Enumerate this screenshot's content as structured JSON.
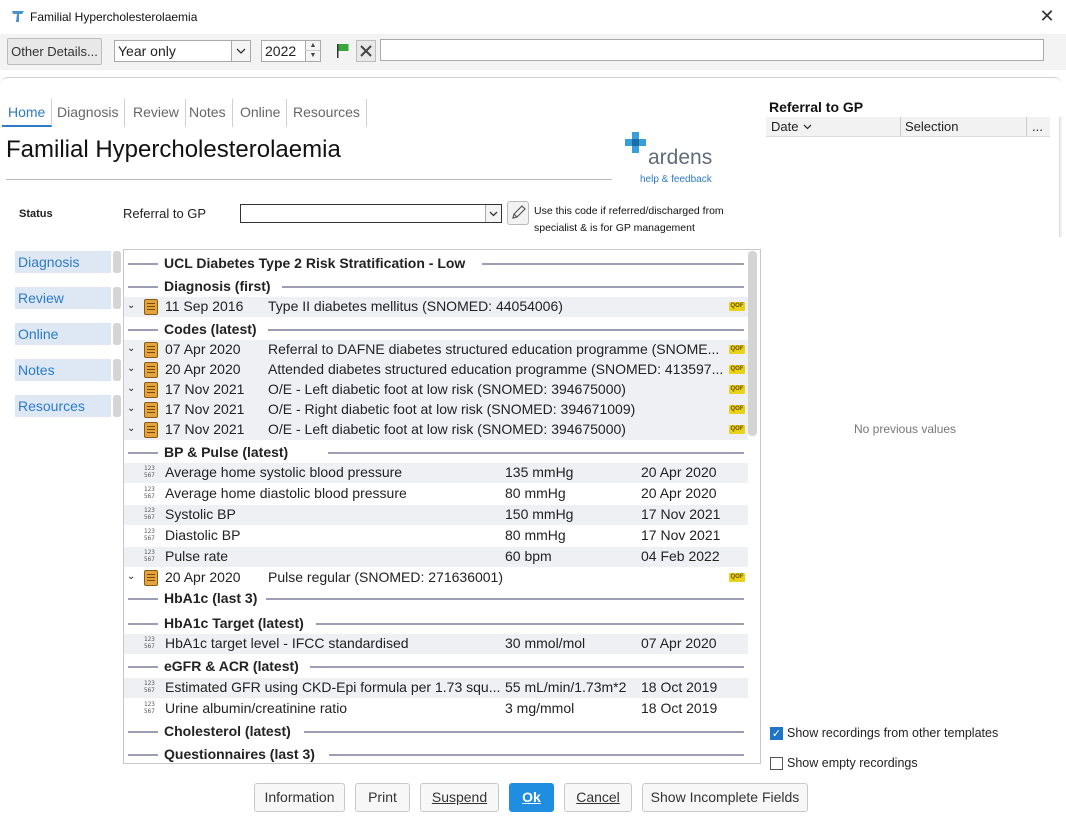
{
  "window": {
    "title": "Familial Hypercholesterolaemia",
    "close_glyph": "✕"
  },
  "toolbar": {
    "other_details_label": "Other Details...",
    "period_value": "Year only",
    "year_value": "2022",
    "filter_text": ""
  },
  "tabs": [
    "Home",
    "Diagnosis",
    "Review",
    "Notes",
    "Online",
    "Resources"
  ],
  "page_title": "Familial Hypercholesterolaemia",
  "logo": {
    "name": "ardens",
    "tagline": "help & feedback",
    "color": "#2c7bc8"
  },
  "status": {
    "label": "Status",
    "field_label": "Referral to GP",
    "field_value": "",
    "note": "Use this code if referred/discharged from specialist & is for GP management"
  },
  "left_nav": [
    "Diagnosis",
    "Review",
    "Online",
    "Notes",
    "Resources"
  ],
  "sections": {
    "s0": "UCL Diabetes Type 2 Risk Stratification - Low",
    "s1": "Diagnosis (first)",
    "s2": "Codes (latest)",
    "s3": "BP & Pulse (latest)",
    "s4": "HbA1c (last 3)",
    "s5": "HbA1c Target (latest)",
    "s6": "eGFR & ACR (latest)",
    "s7": "Cholesterol (latest)",
    "s8": "Questionnaires (last 3)"
  },
  "qof_badge": "QOF",
  "coded_rows": [
    {
      "date": "11 Sep 2016",
      "desc": "Type II diabetes mellitus (SNOMED: 44054006)"
    },
    {
      "date": "07 Apr 2020",
      "desc": "Referral to DAFNE diabetes structured education programme (SNOME..."
    },
    {
      "date": "20 Apr 2020",
      "desc": "Attended diabetes structured education programme (SNOMED: 413597..."
    },
    {
      "date": "17 Nov 2021",
      "desc": "O/E - Left diabetic foot at low risk (SNOMED: 394675000)"
    },
    {
      "date": "17 Nov 2021",
      "desc": "O/E - Right diabetic foot at low risk (SNOMED: 394671009)"
    },
    {
      "date": "17 Nov 2021",
      "desc": "O/E - Left diabetic foot at low risk (SNOMED: 394675000)"
    },
    {
      "date": "20 Apr 2020",
      "desc": "Pulse regular (SNOMED: 271636001)"
    }
  ],
  "value_rows": [
    {
      "name": "Average home systolic blood pressure",
      "value": "135 mmHg",
      "date": "20 Apr 2020"
    },
    {
      "name": "Average home diastolic blood pressure",
      "value": "80 mmHg",
      "date": "20 Apr 2020"
    },
    {
      "name": "Systolic BP",
      "value": "150 mmHg",
      "date": "17 Nov 2021"
    },
    {
      "name": "Diastolic BP",
      "value": "80 mmHg",
      "date": "17 Nov 2021"
    },
    {
      "name": "Pulse rate",
      "value": "60 bpm",
      "date": "04 Feb 2022"
    },
    {
      "name": "HbA1c target level - IFCC standardised",
      "value": "30 mmol/mol",
      "date": "07 Apr 2020"
    },
    {
      "name": "Estimated GFR using CKD-Epi formula per 1.73 squ...",
      "value": "55 mL/min/1.73m*2",
      "date": "18 Oct 2019"
    },
    {
      "name": "Urine albumin/creatinine ratio",
      "value": "3 mg/mmol",
      "date": "18 Oct 2019"
    }
  ],
  "right_panel": {
    "title": "Referral to GP",
    "col_date": "Date",
    "col_selection": "Selection",
    "col_more": "...",
    "empty_text": "No previous values",
    "show_other_templates": "Show recordings from other templates",
    "show_empty": "Show empty recordings"
  },
  "buttons": {
    "information": "Information",
    "print": "Print",
    "suspend": "Suspend",
    "ok": "Ok",
    "cancel": "Cancel",
    "show_incomplete": "Show Incomplete Fields"
  }
}
